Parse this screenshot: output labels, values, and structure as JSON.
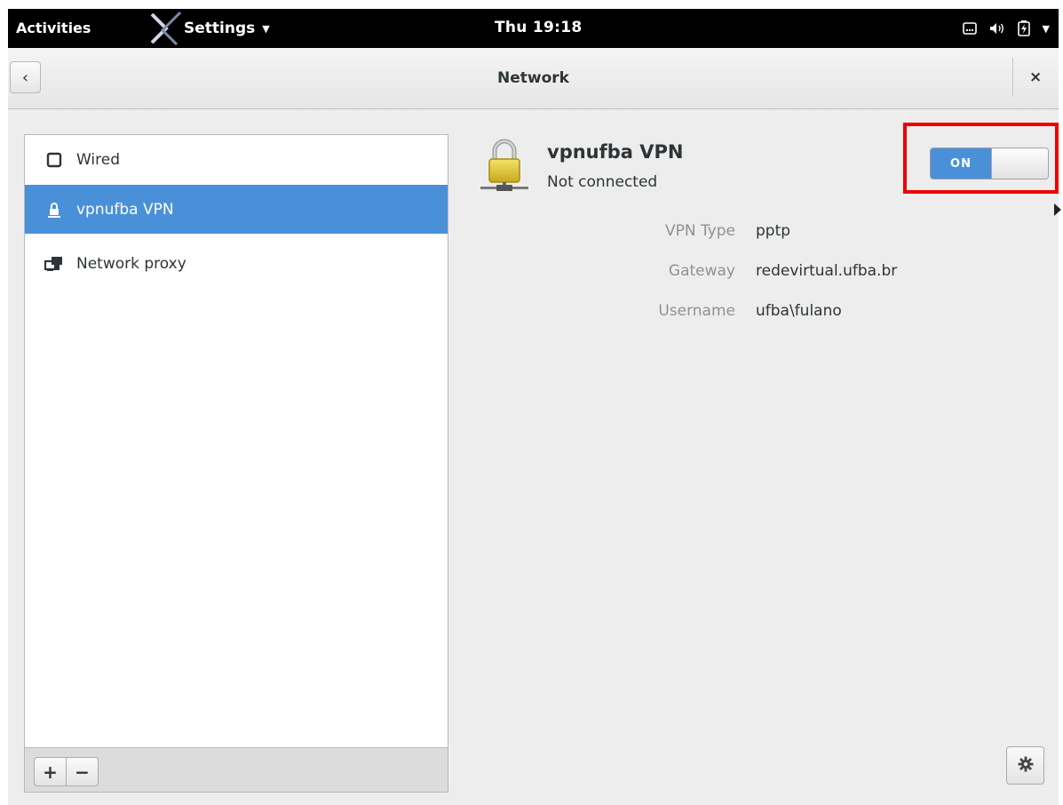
{
  "topbar": {
    "activities": "Activities",
    "app_menu": "Settings",
    "clock": "Thu 19:18"
  },
  "window": {
    "title": "Network",
    "back_glyph": "‹",
    "close_glyph": "×"
  },
  "sidebar": {
    "items": [
      {
        "label": "Wired",
        "icon": "wired-icon",
        "selected": false
      },
      {
        "label": "vpnufba VPN",
        "icon": "vpn-lock-icon",
        "selected": true
      },
      {
        "label": "Network proxy",
        "icon": "network-proxy-icon",
        "selected": false
      }
    ],
    "add_label": "+",
    "remove_label": "−"
  },
  "details": {
    "name": "vpnufba VPN",
    "status": "Not connected",
    "toggle_label": "ON",
    "toggle_on": true,
    "properties": [
      {
        "label": "VPN Type",
        "value": "pptp"
      },
      {
        "label": "Gateway",
        "value": "redevirtual.ufba.br"
      },
      {
        "label": "Username",
        "value": "ufba\\fulano"
      }
    ]
  },
  "colors": {
    "accent": "#4a90d9",
    "highlight": "#ee0000",
    "topbar": "#000000"
  }
}
